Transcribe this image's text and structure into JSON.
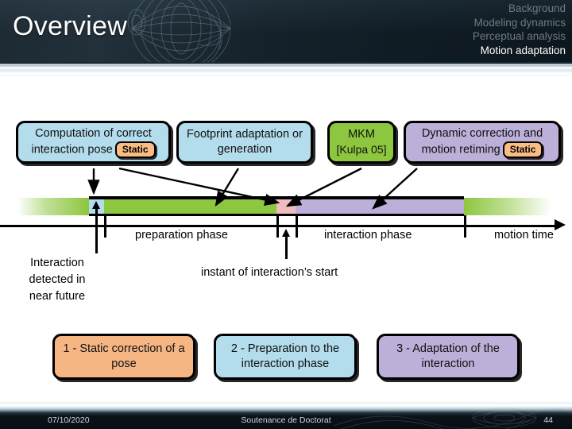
{
  "header": {
    "title": "Overview",
    "nav": [
      {
        "label": "Background",
        "active": false
      },
      {
        "label": "Modeling dynamics",
        "active": false
      },
      {
        "label": "Perceptual analysis",
        "active": false
      },
      {
        "label": "Motion adaptation",
        "active": true
      }
    ]
  },
  "process_boxes": [
    {
      "text": "Computation of correct interaction pose",
      "badge": "Static",
      "color": "#b3dced"
    },
    {
      "text": "Footprint adaptation or generation",
      "badge": null,
      "color": "#b3dced"
    },
    {
      "text": "MKM",
      "citation": "[Kulpa 05]",
      "badge": null,
      "color": "#8dc63f"
    },
    {
      "text": "Dynamic correction and motion retiming",
      "badge": "Static",
      "color": "#bdb0d8"
    }
  ],
  "timeline": {
    "axis_labels": [
      "preparation phase",
      "interaction phase",
      "motion time"
    ],
    "annotations": [
      "Interaction detected in near future",
      "instant of interaction’s start"
    ],
    "segments": [
      {
        "name": "motion-before",
        "color": "#8dc63f"
      },
      {
        "name": "detection",
        "color": "#b3dced"
      },
      {
        "name": "preparation",
        "color": "#8dc63f"
      },
      {
        "name": "contact",
        "color": "#efbcc0"
      },
      {
        "name": "interaction",
        "color": "#bdb0d8"
      },
      {
        "name": "motion-after",
        "color": "#8dc63f"
      }
    ]
  },
  "numbered_boxes": [
    {
      "text": "1 - Static correction of a pose",
      "color": "#f6b684"
    },
    {
      "text": "2 - Preparation to the interaction phase",
      "color": "#b3dced"
    },
    {
      "text": "3 - Adaptation of the interaction",
      "color": "#bdb0d8"
    }
  ],
  "footer": {
    "date": "07/10/2020",
    "center": "Soutenance de Doctorat",
    "page": "44"
  },
  "colors": {
    "blue": "#b3dced",
    "green": "#8dc63f",
    "purple": "#bdb0d8",
    "orange": "#f6b684",
    "badge_orange": "#f9bd84",
    "pink": "#efbcc0",
    "header_dark": "#16222b"
  }
}
